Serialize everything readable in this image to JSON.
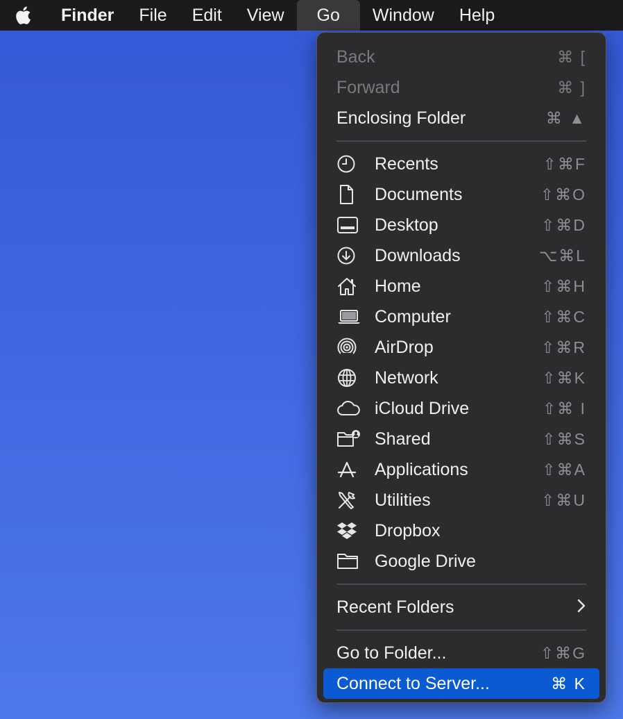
{
  "menubar": {
    "app": "Finder",
    "items": [
      "File",
      "Edit",
      "View",
      "Go",
      "Window",
      "Help"
    ]
  },
  "menu": {
    "top": [
      {
        "label": "Back",
        "shortcut": "⌘ [",
        "disabled": true
      },
      {
        "label": "Forward",
        "shortcut": "⌘ ]",
        "disabled": true
      },
      {
        "label": "Enclosing Folder",
        "shortcut": "⌘ ▲",
        "disabled": false
      }
    ],
    "places": [
      {
        "label": "Recents",
        "shortcut": "⇧⌘F",
        "icon": "clock-icon"
      },
      {
        "label": "Documents",
        "shortcut": "⇧⌘O",
        "icon": "document-icon"
      },
      {
        "label": "Desktop",
        "shortcut": "⇧⌘D",
        "icon": "desktop-icon"
      },
      {
        "label": "Downloads",
        "shortcut": "⌥⌘L",
        "icon": "download-icon"
      },
      {
        "label": "Home",
        "shortcut": "⇧⌘H",
        "icon": "home-icon"
      },
      {
        "label": "Computer",
        "shortcut": "⇧⌘C",
        "icon": "laptop-icon"
      },
      {
        "label": "AirDrop",
        "shortcut": "⇧⌘R",
        "icon": "airdrop-icon"
      },
      {
        "label": "Network",
        "shortcut": "⇧⌘K",
        "icon": "globe-icon"
      },
      {
        "label": "iCloud Drive",
        "shortcut": "⇧⌘ I",
        "icon": "cloud-icon"
      },
      {
        "label": "Shared",
        "shortcut": "⇧⌘S",
        "icon": "shared-folder-icon"
      },
      {
        "label": "Applications",
        "shortcut": "⇧⌘A",
        "icon": "applications-icon"
      },
      {
        "label": "Utilities",
        "shortcut": "⇧⌘U",
        "icon": "utilities-icon"
      },
      {
        "label": "Dropbox",
        "shortcut": "",
        "icon": "dropbox-icon"
      },
      {
        "label": "Google Drive",
        "shortcut": "",
        "icon": "folder-icon"
      }
    ],
    "recent_folders": "Recent Folders",
    "bottom": [
      {
        "label": "Go to Folder...",
        "shortcut": "⇧⌘G"
      },
      {
        "label": "Connect to Server...",
        "shortcut": "⌘ K",
        "selected": true
      }
    ]
  },
  "colors": {
    "selection": "#0a5ad2",
    "menu_bg": "#2c2c2e",
    "desktop": "#3f66e0"
  }
}
